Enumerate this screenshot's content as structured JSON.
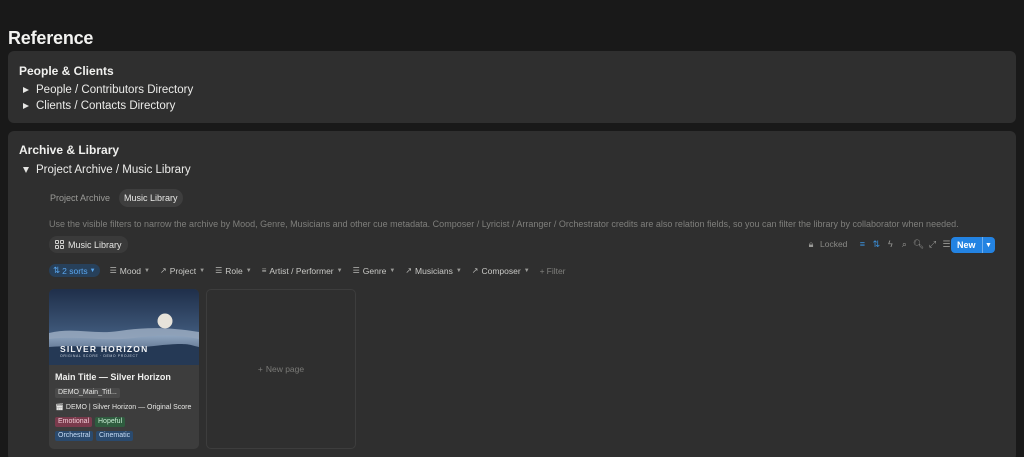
{
  "page": {
    "title": "Reference"
  },
  "people_section": {
    "title": "People & Clients",
    "items": [
      {
        "label": "People / Contributors Directory"
      },
      {
        "label": "Clients / Contacts Directory"
      }
    ]
  },
  "archive_section": {
    "title": "Archive & Library",
    "toggle": {
      "label": "Project Archive / Music Library"
    },
    "view_tabs": [
      {
        "label": "Project Archive",
        "active": false
      },
      {
        "label": "Music Library",
        "active": true
      }
    ],
    "description": "Use the visible filters to narrow the archive by Mood, Genre, Musicians and other cue metadata. Composer / Lyricist / Arranger / Orchestrator credits are also relation fields, so you can filter the library by collaborator when needed.",
    "database_view": {
      "label": "Music Library",
      "icon": "gallery-grid-icon"
    },
    "toolbar": {
      "locked_label": "Locked",
      "new_label": "New"
    },
    "sorts_label": "2 sorts",
    "filters": [
      {
        "label": "Mood",
        "icon": "list-icon"
      },
      {
        "label": "Project",
        "icon": "relation-arrow-icon"
      },
      {
        "label": "Role",
        "icon": "list-icon"
      },
      {
        "label": "Artist / Performer",
        "icon": "text-lines-icon"
      },
      {
        "label": "Genre",
        "icon": "list-icon"
      },
      {
        "label": "Musicians",
        "icon": "relation-arrow-icon"
      },
      {
        "label": "Composer",
        "icon": "relation-arrow-icon"
      }
    ],
    "add_filter_label": "Filter",
    "card": {
      "cover_title": "SILVER HORIZON",
      "cover_subtitle": "ORIGINAL SCORE · DEMO PROJECT",
      "title": "Main Title — Silver Horizon",
      "file_chip": "DEMO_Main_Titl...",
      "project_relation": "DEMO | Silver Horizon — Original Score",
      "tags": [
        {
          "label": "Emotional",
          "color": "#7a3a4c",
          "text_color": "#f3cdd7"
        },
        {
          "label": "Hopeful",
          "color": "#2f5c3f",
          "text_color": "#c7ecd2"
        },
        {
          "label": "Orchestral",
          "color": "#2a4a6e",
          "text_color": "#c6dcf5"
        },
        {
          "label": "Cinematic",
          "color": "#2a4a6e",
          "text_color": "#c6dcf5"
        }
      ]
    },
    "new_page_label": "New page"
  },
  "colors": {
    "accent": "#2383e2",
    "background": "#191919",
    "panel": "#2f2f2f"
  }
}
